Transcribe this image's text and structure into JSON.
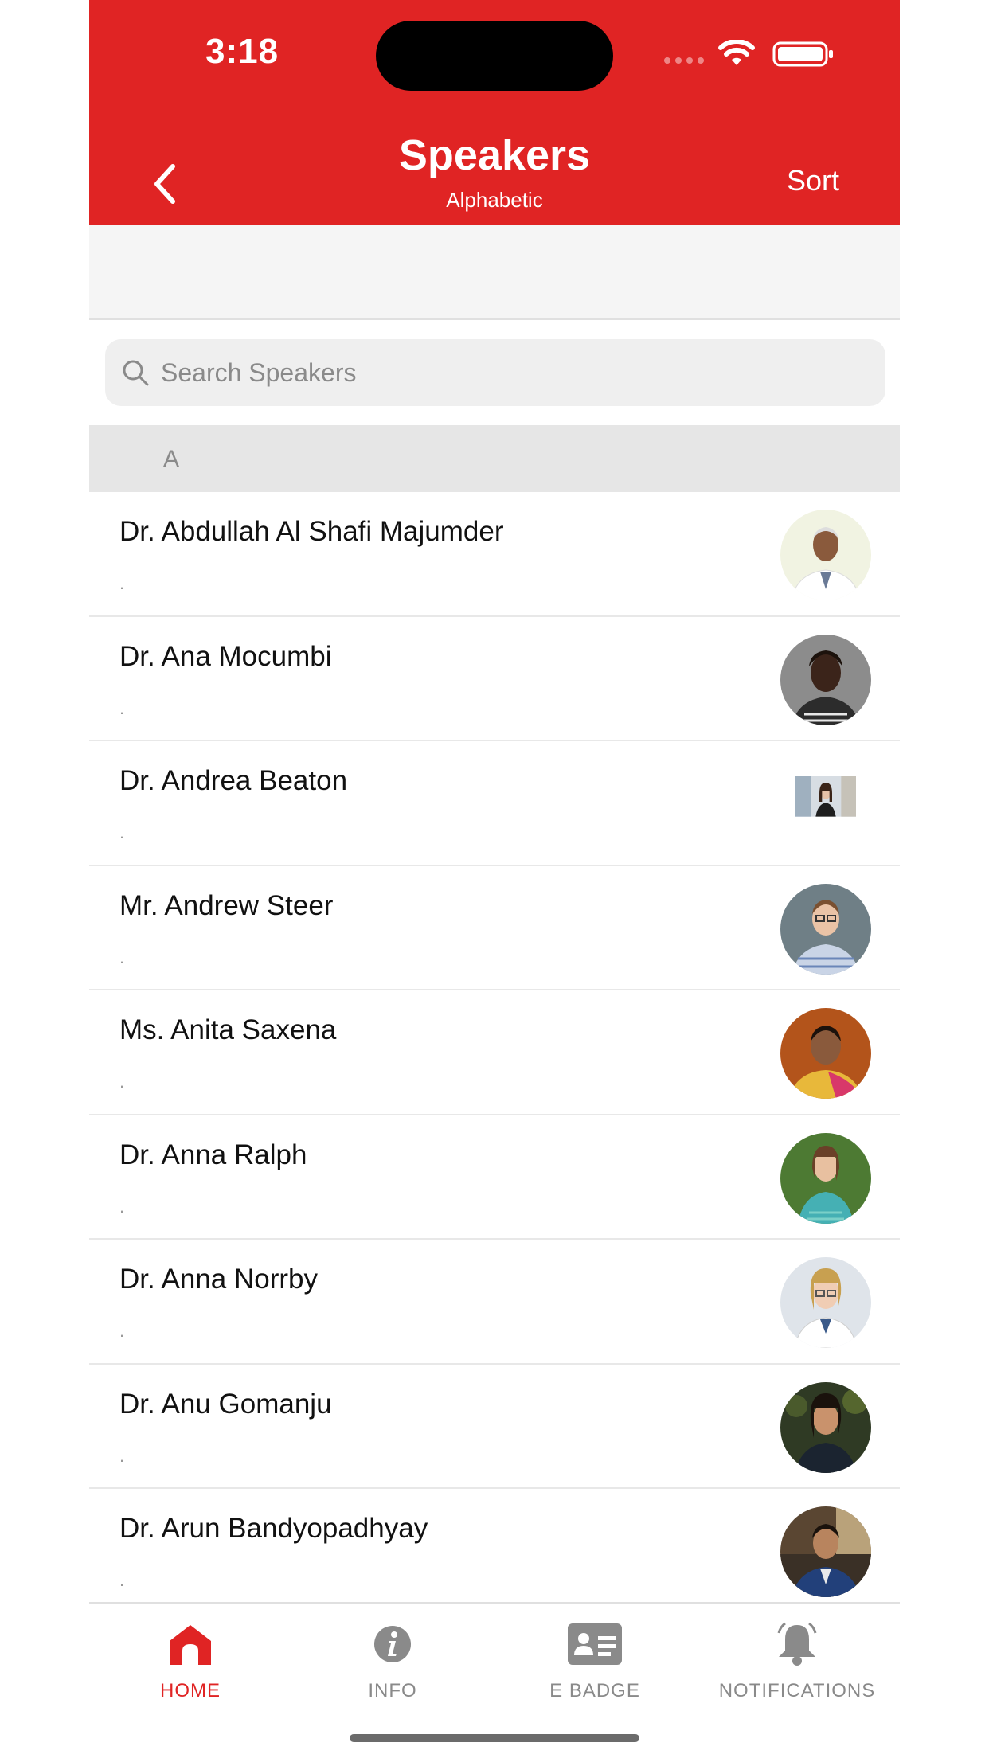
{
  "status_bar": {
    "time": "3:18"
  },
  "header": {
    "title": "Speakers",
    "subtitle": "Alphabetic",
    "sort_label": "Sort",
    "background_color": "#e02424"
  },
  "search": {
    "placeholder": "Search Speakers",
    "value": ""
  },
  "section": {
    "letter": "A"
  },
  "speakers": [
    {
      "name": "Dr. Abdullah Al Shafi Majumder",
      "sub": "."
    },
    {
      "name": "Dr. Ana Mocumbi",
      "sub": "."
    },
    {
      "name": "Dr. Andrea Beaton",
      "sub": "."
    },
    {
      "name": "Mr. Andrew Steer",
      "sub": "."
    },
    {
      "name": "Ms. Anita Saxena",
      "sub": "."
    },
    {
      "name": "Dr. Anna Ralph",
      "sub": "."
    },
    {
      "name": "Dr. Anna Norrby",
      "sub": "."
    },
    {
      "name": "Dr. Anu Gomanju",
      "sub": "."
    },
    {
      "name": "Dr. Arun Bandyopadhyay",
      "sub": "."
    }
  ],
  "tabs": [
    {
      "label": "HOME",
      "icon": "home-icon",
      "active": true
    },
    {
      "label": "INFO",
      "icon": "info-icon",
      "active": false
    },
    {
      "label": "E BADGE",
      "icon": "badge-icon",
      "active": false
    },
    {
      "label": "NOTIFICATIONS",
      "icon": "bell-icon",
      "active": false
    }
  ],
  "colors": {
    "accent": "#e02424",
    "inactive_tab": "#8a8a8a"
  }
}
